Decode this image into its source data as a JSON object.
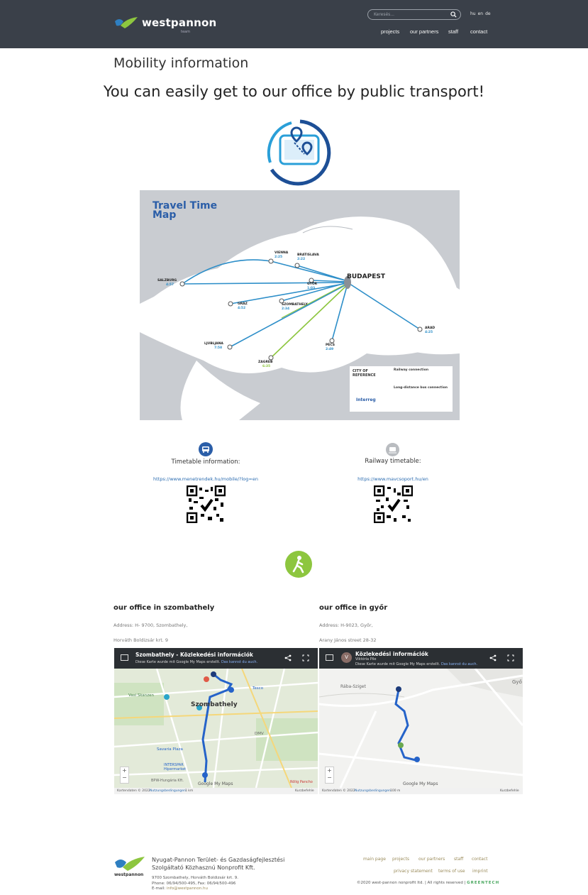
{
  "header": {
    "logo_text": "westpannon",
    "logo_sub": "team",
    "search_placeholder": "Keresés...",
    "languages": [
      "hu",
      "en",
      "de"
    ],
    "nav": [
      "projects",
      "our partners",
      "staff",
      "contact"
    ]
  },
  "page_title": "Mobility information",
  "headline": "You can easily get to our office by public transport!",
  "travel_map": {
    "title_line1": "Travel Time",
    "title_line2": "Map",
    "cities": [
      {
        "name": "VIENNA",
        "time": "2:25"
      },
      {
        "name": "BRATISLAVA",
        "time": "2:22"
      },
      {
        "name": "SALZBURG",
        "time": "4:57"
      },
      {
        "name": "GYŐR",
        "time": "1:03"
      },
      {
        "name": "GRAZ",
        "time": "4:52"
      },
      {
        "name": "SZOMBATHELY",
        "time": "2:34"
      },
      {
        "name": "LJUBLJANA",
        "time": "7:58"
      },
      {
        "name": "PÉCS",
        "time": "2:49"
      },
      {
        "name": "ZAGREB",
        "time": "6:35"
      },
      {
        "name": "ARAD",
        "time": "4:25"
      }
    ],
    "hub": "BUDAPEST",
    "legend": {
      "city_ref": "CITY OF REFERENCE",
      "railway": "Railway connection",
      "bus": "Long-distance bus connection",
      "brand": "Interreg"
    }
  },
  "timetable": {
    "bus_label": "Timetable information:",
    "bus_link": "https://www.menetrendek.hu/mobile/?log=en",
    "rail_label": "Railway timetable:",
    "rail_link": "https://www.mavcsoport.hu/en"
  },
  "offices": {
    "szombathely": {
      "title": "our office in szombathely",
      "address1": "Address: H- 9700, Szombathely,",
      "address2": "Horváth Boldizsár krt. 9",
      "map_title": "Szombathely - Közlekedési információk",
      "map_sub": "Diese Karte wurde mit Google My Maps erstellt.",
      "map_sub_link": "Das kannst du auch.",
      "city_label": "Szombathely",
      "places": [
        "Vasi Skanzen",
        "Tesco",
        "Savaria Plaza",
        "INTERSPAR Hipermarket",
        "DMV",
        "BPW-Hungária Kft.",
        "Rölig Pancho"
      ],
      "footer_left": "Kartendaten © 2022",
      "footer_mid": "Nutzungsbedingungen",
      "footer_scale": "1 km",
      "footer_right": "Kurzbefehle",
      "google_label": "Google My Maps"
    },
    "gyor": {
      "title": "our office in győr",
      "address1": "Address: H-9023, Győr,",
      "address2": "Arany János street 28-32",
      "map_title": "Közlekedési információk",
      "map_author": "Viktória Pile",
      "map_sub": "Diese Karte wurde mit Google My Maps erstellt.",
      "map_sub_link": "Das kannst du auch.",
      "avatar": "V",
      "places": [
        "Rába-Sziget",
        "Győ"
      ],
      "footer_left": "Kartendaten © 2022",
      "footer_mid": "Nutzungsbedingungen",
      "footer_scale": "100 m",
      "footer_right": "Kurzbefehle",
      "google_label": "Google My Maps"
    }
  },
  "footer": {
    "company_line1": "Nyugat-Pannon Terület- és Gazdaságfejlesztési",
    "company_line2": "Szolgáltató Közhasznú Nonprofit Kft.",
    "address": "9700 Szombathely, Horváth Boldizsár krt. 9.",
    "phone": "Phone: 06/94/500-495, Fax: 06/94/500-496",
    "email_label": "E-mail:",
    "email": "info@westpannon.hu",
    "links_row1": [
      "main page",
      "projects",
      "our partners",
      "staff",
      "contact"
    ],
    "links_row2": [
      "privacy statement",
      "terms of use",
      "imprint"
    ],
    "copyright": "©2020 west-pannon nonprofit ltd. | All rights reserved |",
    "brand": "GREENTECH"
  },
  "colors": {
    "header_bg": "#3a4049",
    "accent_blue": "#2b5ea8",
    "accent_green": "#8dc63f",
    "link_blue": "#2b6cb0"
  }
}
